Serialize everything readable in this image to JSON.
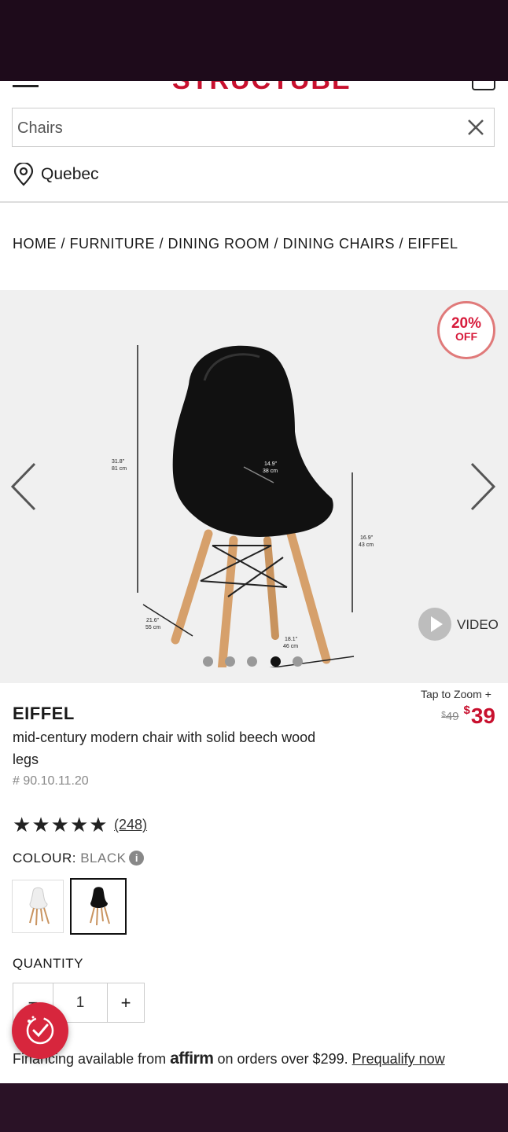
{
  "header": {
    "logo": "STRUCTUBE",
    "menu_icon": "hamburger-menu-icon",
    "cart_icon": "shopping-bag-icon"
  },
  "search": {
    "value": "Chairs",
    "clear_icon": "close-icon"
  },
  "location": {
    "label": "Quebec",
    "icon": "map-pin-icon"
  },
  "breadcrumb": "HOME / FURNITURE / DINING ROOM / DINING CHAIRS  / EIFFEL",
  "gallery": {
    "badge_percent": "20%",
    "badge_off": "OFF",
    "video_label": "VIDEO",
    "slides_total": 5,
    "active_slide": 4,
    "dimensions": {
      "height_in": "31.8\"",
      "height_cm": "81 cm",
      "seat_w_in": "14.9\"",
      "seat_w_cm": "38 cm",
      "seat_h_in": "16.9\"",
      "seat_h_cm": "43 cm",
      "depth_in": "21.6\"",
      "depth_cm": "55 cm",
      "width_in": "18.1\"",
      "width_cm": "46 cm"
    }
  },
  "product": {
    "zoom_label": "Tap to Zoom",
    "name": "EIFFEL",
    "description": "mid-century modern chair with solid beech wood legs",
    "sku": "# 90.10.11.20",
    "old_price": "49",
    "new_price": "39",
    "currency": "$",
    "rating_stars": 5,
    "reviews": "(248)"
  },
  "colour": {
    "label": "COLOUR:",
    "value": "BLACK",
    "info_icon": "info-icon",
    "swatches": [
      "White",
      "Black"
    ],
    "selected": "Black"
  },
  "quantity": {
    "label": "QUANTITY",
    "value": "1",
    "minus": "−",
    "plus": "+"
  },
  "financing": {
    "prefix": "Financing available from",
    "brand": "affirm",
    "suffix": "on orders over $299.",
    "link": "Prequalify now"
  },
  "colors": {
    "brand_red": "#c8102e",
    "status_bar": "#1e0b1b",
    "fab": "#d7263d"
  }
}
